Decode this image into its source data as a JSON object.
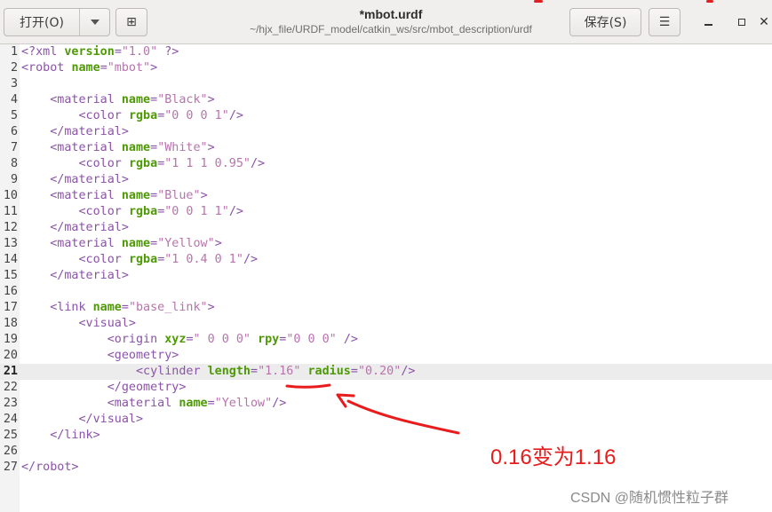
{
  "header": {
    "open_label": "打开(O)",
    "new_tab_glyph": "⊞",
    "title": "*mbot.urdf",
    "path": "~/hjx_file/URDF_model/catkin_ws/src/mbot_description/urdf",
    "save_label": "保存(S)",
    "menu_glyph": "☰",
    "close_glyph": "✕"
  },
  "editor": {
    "current_line": 21,
    "lines": [
      {
        "n": "1",
        "t": [
          [
            "tag",
            "<?xml "
          ],
          [
            "attr",
            "version"
          ],
          [
            "tag",
            "="
          ],
          [
            "str",
            "\"1.0\""
          ],
          [
            "tag",
            " ?>"
          ]
        ]
      },
      {
        "n": "2",
        "t": [
          [
            "tag",
            "<robot "
          ],
          [
            "attr",
            "name"
          ],
          [
            "tag",
            "="
          ],
          [
            "str",
            "\"mbot\""
          ],
          [
            "tag",
            ">"
          ]
        ]
      },
      {
        "n": "3",
        "t": []
      },
      {
        "n": "4",
        "t": [
          [
            "plain",
            "    "
          ],
          [
            "tag",
            "<material "
          ],
          [
            "attr",
            "name"
          ],
          [
            "tag",
            "="
          ],
          [
            "str",
            "\"Black\""
          ],
          [
            "tag",
            ">"
          ]
        ]
      },
      {
        "n": "5",
        "t": [
          [
            "plain",
            "        "
          ],
          [
            "tag",
            "<color "
          ],
          [
            "attr",
            "rgba"
          ],
          [
            "tag",
            "="
          ],
          [
            "str",
            "\"0 0 0 1\""
          ],
          [
            "tag",
            "/>"
          ]
        ]
      },
      {
        "n": "6",
        "t": [
          [
            "plain",
            "    "
          ],
          [
            "tag",
            "</material>"
          ]
        ]
      },
      {
        "n": "7",
        "t": [
          [
            "plain",
            "    "
          ],
          [
            "tag",
            "<material "
          ],
          [
            "attr",
            "name"
          ],
          [
            "tag",
            "="
          ],
          [
            "str",
            "\"White\""
          ],
          [
            "tag",
            ">"
          ]
        ]
      },
      {
        "n": "8",
        "t": [
          [
            "plain",
            "        "
          ],
          [
            "tag",
            "<color "
          ],
          [
            "attr",
            "rgba"
          ],
          [
            "tag",
            "="
          ],
          [
            "str",
            "\"1 1 1 0.95\""
          ],
          [
            "tag",
            "/>"
          ]
        ]
      },
      {
        "n": "9",
        "t": [
          [
            "plain",
            "    "
          ],
          [
            "tag",
            "</material>"
          ]
        ]
      },
      {
        "n": "10",
        "t": [
          [
            "plain",
            "    "
          ],
          [
            "tag",
            "<material "
          ],
          [
            "attr",
            "name"
          ],
          [
            "tag",
            "="
          ],
          [
            "str",
            "\"Blue\""
          ],
          [
            "tag",
            ">"
          ]
        ]
      },
      {
        "n": "11",
        "t": [
          [
            "plain",
            "        "
          ],
          [
            "tag",
            "<color "
          ],
          [
            "attr",
            "rgba"
          ],
          [
            "tag",
            "="
          ],
          [
            "str",
            "\"0 0 1 1\""
          ],
          [
            "tag",
            "/>"
          ]
        ]
      },
      {
        "n": "12",
        "t": [
          [
            "plain",
            "    "
          ],
          [
            "tag",
            "</material>"
          ]
        ]
      },
      {
        "n": "13",
        "t": [
          [
            "plain",
            "    "
          ],
          [
            "tag",
            "<material "
          ],
          [
            "attr",
            "name"
          ],
          [
            "tag",
            "="
          ],
          [
            "str",
            "\"Yellow\""
          ],
          [
            "tag",
            ">"
          ]
        ]
      },
      {
        "n": "14",
        "t": [
          [
            "plain",
            "        "
          ],
          [
            "tag",
            "<color "
          ],
          [
            "attr",
            "rgba"
          ],
          [
            "tag",
            "="
          ],
          [
            "str",
            "\"1 0.4 0 1\""
          ],
          [
            "tag",
            "/>"
          ]
        ]
      },
      {
        "n": "15",
        "t": [
          [
            "plain",
            "    "
          ],
          [
            "tag",
            "</material>"
          ]
        ]
      },
      {
        "n": "16",
        "t": []
      },
      {
        "n": "17",
        "t": [
          [
            "plain",
            "    "
          ],
          [
            "tag",
            "<link "
          ],
          [
            "attr",
            "name"
          ],
          [
            "tag",
            "="
          ],
          [
            "str",
            "\"base_link\""
          ],
          [
            "tag",
            ">"
          ]
        ]
      },
      {
        "n": "18",
        "t": [
          [
            "plain",
            "        "
          ],
          [
            "tag",
            "<visual>"
          ]
        ]
      },
      {
        "n": "19",
        "t": [
          [
            "plain",
            "            "
          ],
          [
            "tag",
            "<origin "
          ],
          [
            "attr",
            "xyz"
          ],
          [
            "tag",
            "="
          ],
          [
            "str",
            "\" 0 0 0\""
          ],
          [
            "plain",
            " "
          ],
          [
            "attr",
            "rpy"
          ],
          [
            "tag",
            "="
          ],
          [
            "str",
            "\"0 0 0\""
          ],
          [
            "plain",
            " "
          ],
          [
            "tag",
            "/>"
          ]
        ]
      },
      {
        "n": "20",
        "t": [
          [
            "plain",
            "            "
          ],
          [
            "tag",
            "<geometry>"
          ]
        ]
      },
      {
        "n": "21",
        "t": [
          [
            "plain",
            "                "
          ],
          [
            "tag",
            "<cylinder "
          ],
          [
            "attr",
            "length"
          ],
          [
            "tag",
            "="
          ],
          [
            "str",
            "\"1.16\""
          ],
          [
            "plain",
            " "
          ],
          [
            "attr",
            "radius"
          ],
          [
            "tag",
            "="
          ],
          [
            "str",
            "\"0.20\""
          ],
          [
            "tag",
            "/>"
          ]
        ]
      },
      {
        "n": "22",
        "t": [
          [
            "plain",
            "            "
          ],
          [
            "tag",
            "</geometry>"
          ]
        ]
      },
      {
        "n": "23",
        "t": [
          [
            "plain",
            "            "
          ],
          [
            "tag",
            "<material "
          ],
          [
            "attr",
            "name"
          ],
          [
            "tag",
            "="
          ],
          [
            "str",
            "\"Yellow\""
          ],
          [
            "tag",
            "/>"
          ]
        ]
      },
      {
        "n": "24",
        "t": [
          [
            "plain",
            "        "
          ],
          [
            "tag",
            "</visual>"
          ]
        ]
      },
      {
        "n": "25",
        "t": [
          [
            "plain",
            "    "
          ],
          [
            "tag",
            "</link>"
          ]
        ]
      },
      {
        "n": "26",
        "t": []
      },
      {
        "n": "27",
        "t": [
          [
            "tag",
            "</robot>"
          ]
        ]
      }
    ]
  },
  "annotation": {
    "text": "0.16变为1.16",
    "color": "#e81c1c"
  },
  "watermark": "CSDN @随机惯性粒子群",
  "colors": {
    "tag": "#8b53a8",
    "attr": "#4e9a06",
    "string": "#b873ad",
    "current_line_bg": "#ececec"
  }
}
